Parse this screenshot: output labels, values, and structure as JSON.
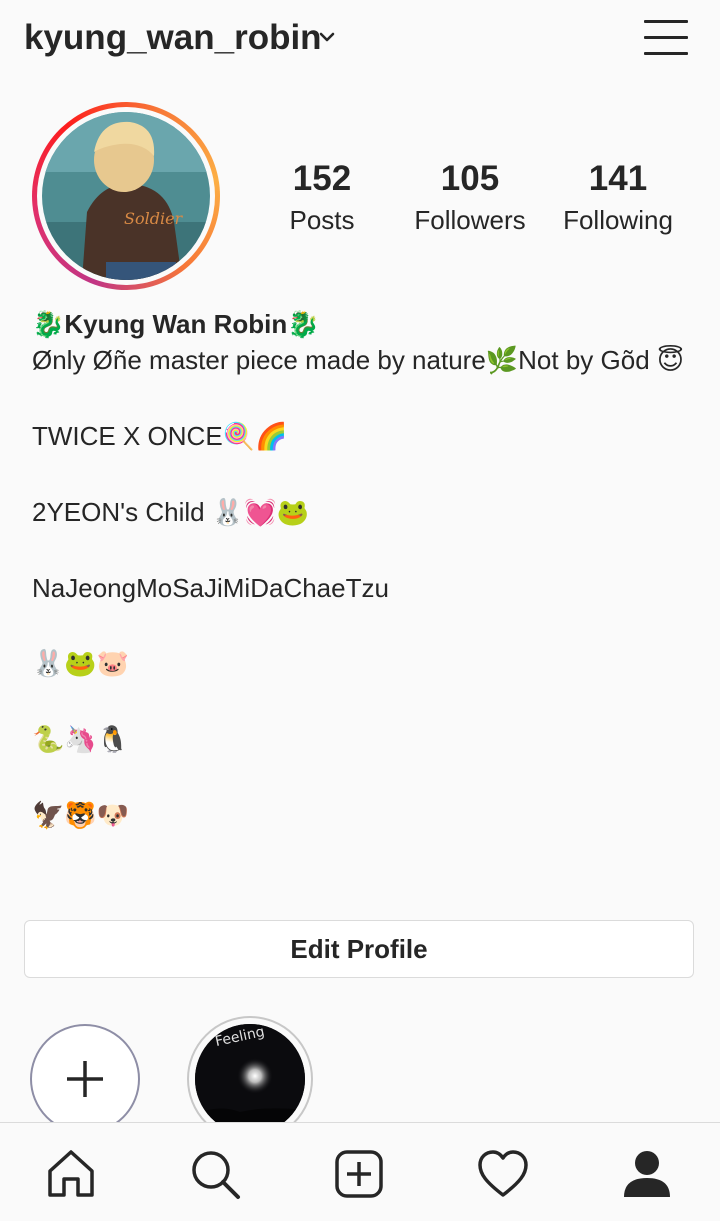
{
  "header": {
    "username": "kyung_wan_robin",
    "dropdown_icon": "chevron-down-icon",
    "menu_icon": "hamburger-menu-icon"
  },
  "profile": {
    "stats": [
      {
        "value": "152",
        "label": "Posts"
      },
      {
        "value": "105",
        "label": "Followers"
      },
      {
        "value": "141",
        "label": "Following"
      }
    ],
    "avatar_colors": {
      "ring_start": "#c13584",
      "ring_end": "#fcaf45"
    }
  },
  "bio": {
    "name": "🐉Kyung Wan Robin🐉",
    "line1": "Ønly Øñe master piece made by nature🌿Not by Gõd 😇",
    "line2": "TWICE X ONCE🍭🌈",
    "line3": "2YEON's Child 🐰💓🐸",
    "line4": "NaJeongMoSaJiMiDaChaeTzu",
    "line5": "🐰🐸🐷",
    "line6": "🐍🦄🐧",
    "line7": "🦅🐯🐶"
  },
  "actions": {
    "edit_profile_label": "Edit Profile"
  },
  "highlights": {
    "new_icon": "plus-icon",
    "story_caption": "Feeling"
  },
  "tabbar": {
    "items": [
      "home-icon",
      "search-icon",
      "add-post-icon",
      "heart-icon",
      "profile-icon"
    ]
  }
}
